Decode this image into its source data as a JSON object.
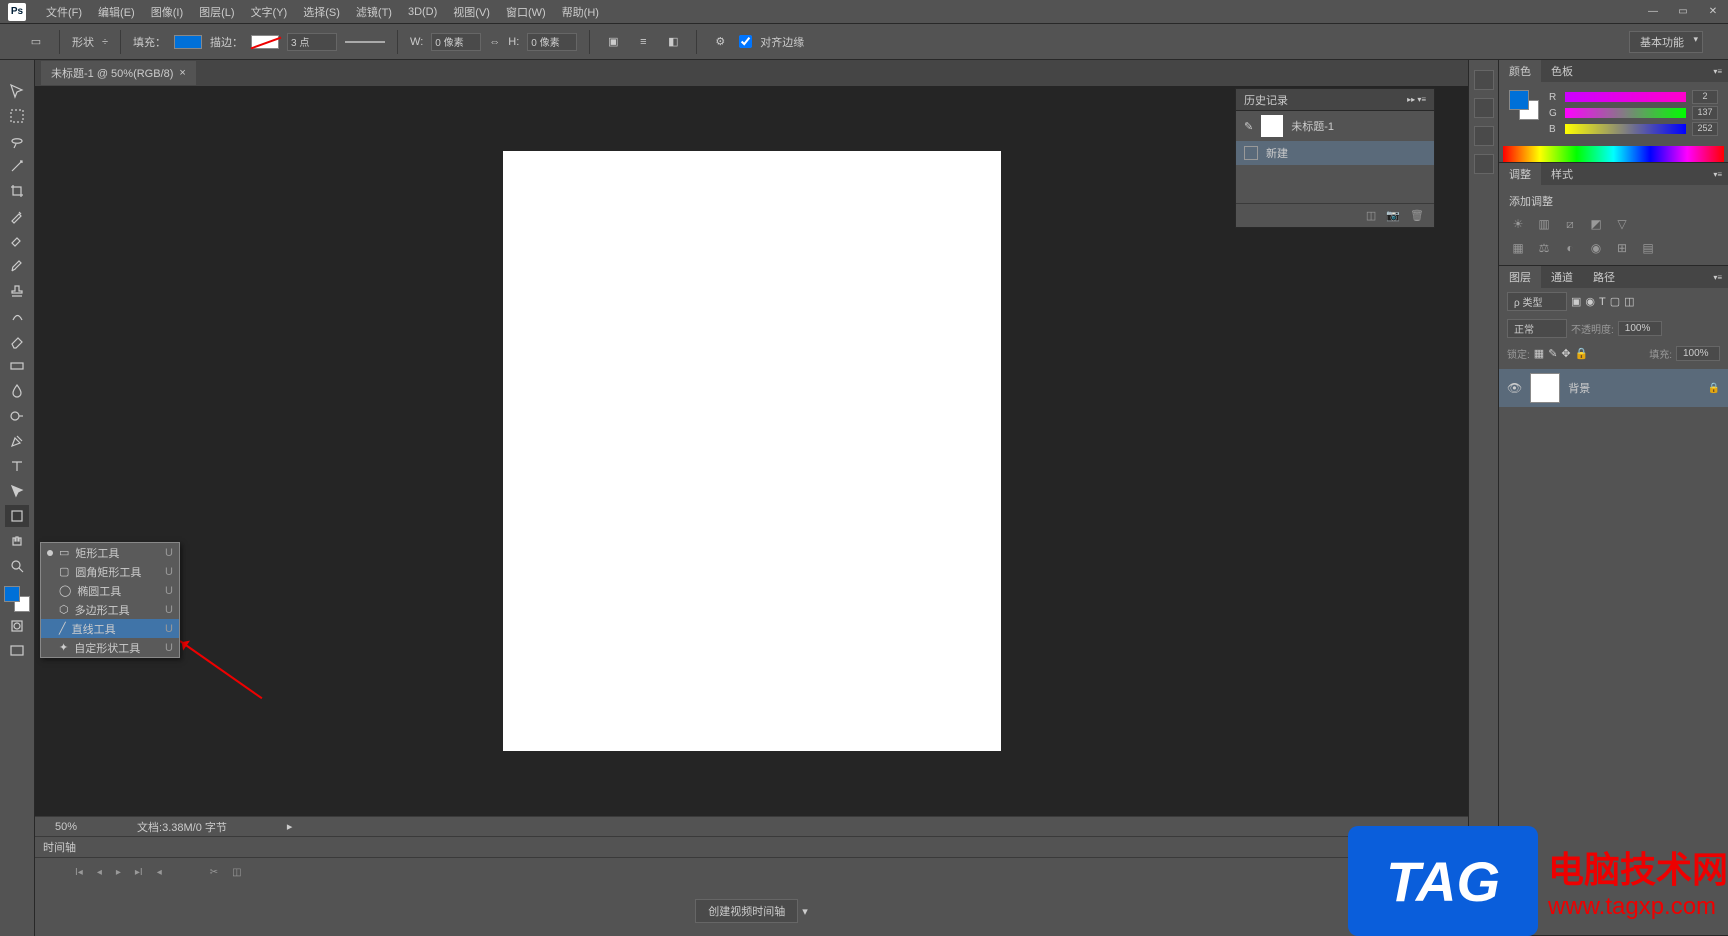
{
  "menu": {
    "file": "文件(F)",
    "edit": "编辑(E)",
    "image": "图像(I)",
    "layer": "图层(L)",
    "type": "文字(Y)",
    "select": "选择(S)",
    "filter": "滤镜(T)",
    "threed": "3D(D)",
    "view": "视图(V)",
    "window": "窗口(W)",
    "help": "帮助(H)"
  },
  "optbar": {
    "shape": "形状",
    "fill": "填充：",
    "stroke": "描边：",
    "strokeVal": "3 点",
    "w": "W:",
    "wVal": "0 像素",
    "h": "H:",
    "hVal": "0 像素",
    "align": "对齐边缘",
    "workspace": "基本功能"
  },
  "doc": {
    "tab": "未标题-1 @ 50%(RGB/8)",
    "zoom": "50%",
    "info": "文档:3.38M/0 字节"
  },
  "flyout": {
    "rect": "矩形工具",
    "roundrect": "圆角矩形工具",
    "ellipse": "椭圆工具",
    "polygon": "多边形工具",
    "line": "直线工具",
    "custom": "自定形状工具",
    "key": "U"
  },
  "timeline": {
    "title": "时间轴",
    "create": "创建视频时间轴"
  },
  "history": {
    "title": "历史记录",
    "doc": "未标题-1",
    "entry": "新建"
  },
  "color": {
    "tab1": "颜色",
    "tab2": "色板",
    "r": "R",
    "rv": "2",
    "g": "G",
    "gv": "137",
    "b": "B",
    "bv": "252"
  },
  "adjust": {
    "tab1": "调整",
    "tab2": "样式",
    "add": "添加调整"
  },
  "layers": {
    "tab1": "图层",
    "tab2": "通道",
    "tab3": "路径",
    "kind": "ρ 类型",
    "blend": "正常",
    "opacity": "不透明度:",
    "opVal": "100%",
    "lock": "锁定:",
    "fill": "填充:",
    "fillVal": "100%",
    "layer": "背景"
  },
  "wm": {
    "tag": "TAG",
    "l1": "电脑技术网",
    "l2": "www.tagxp.com"
  }
}
